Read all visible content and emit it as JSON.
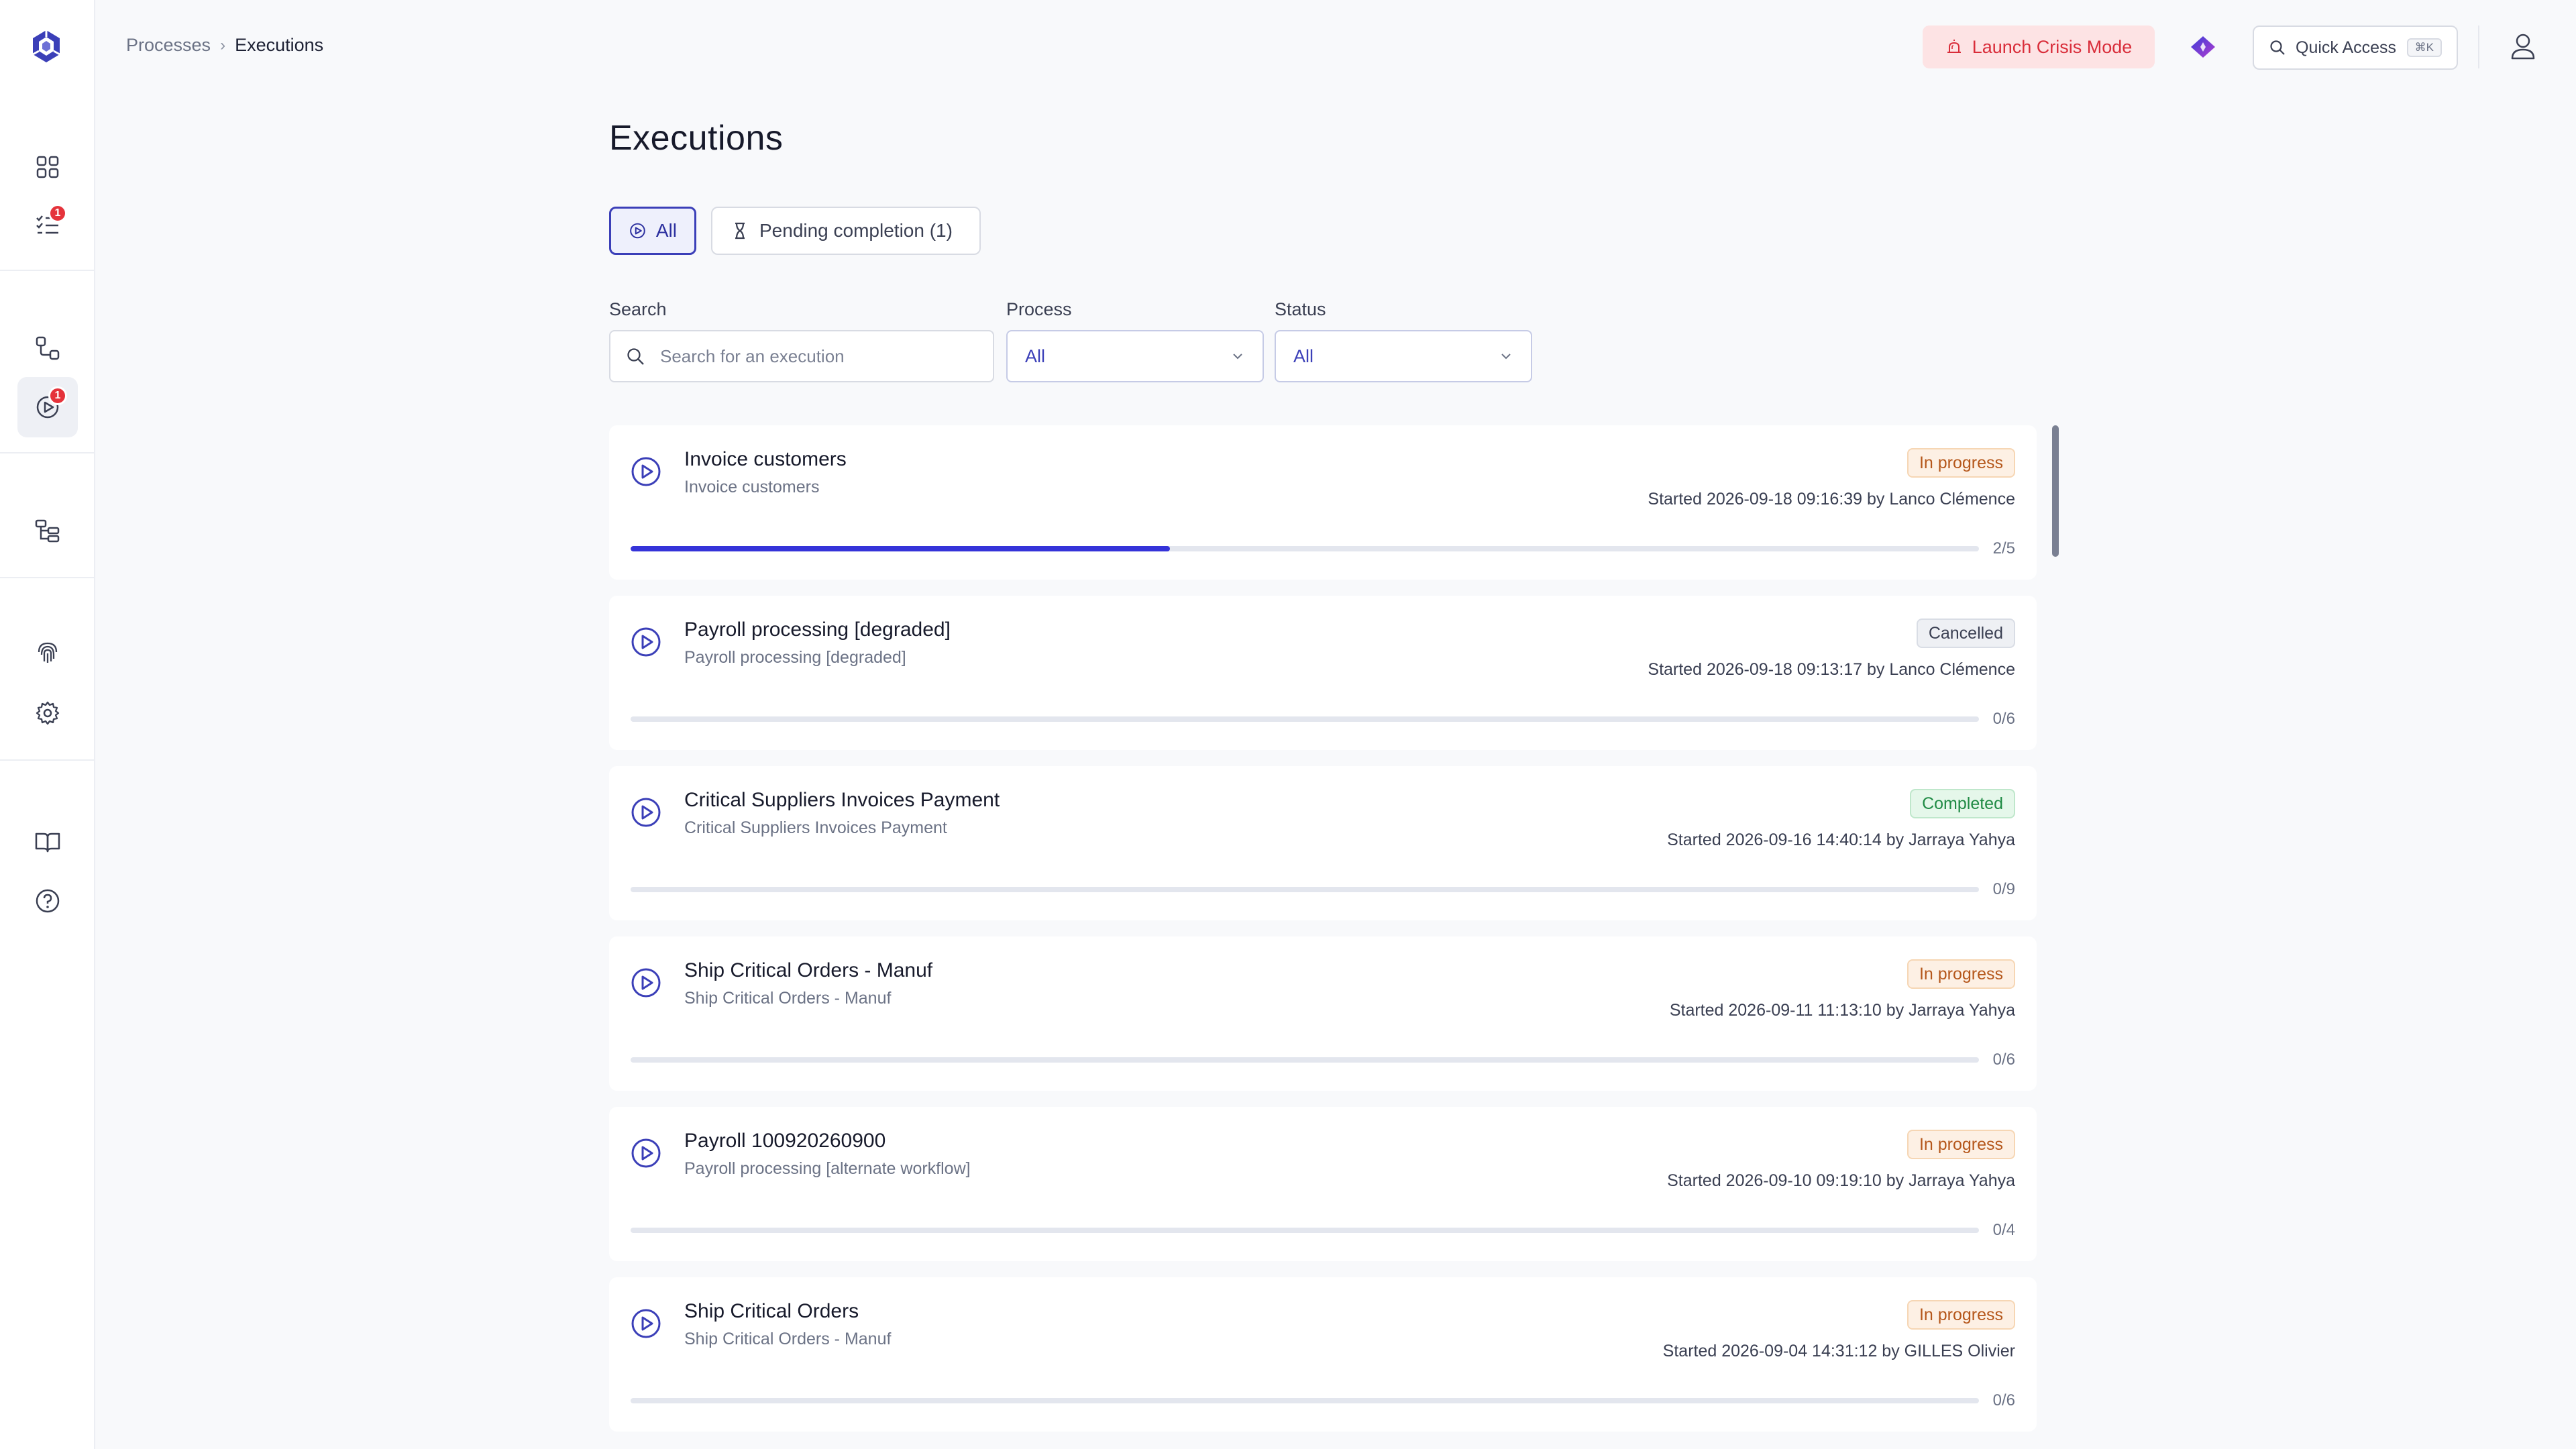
{
  "breadcrumb": {
    "parent": "Processes",
    "separator": "›",
    "current": "Executions"
  },
  "header": {
    "crisis_button": "Launch Crisis Mode",
    "quick_access": {
      "label": "Quick Access",
      "shortcut": "⌘K"
    }
  },
  "sidebar": {
    "badges": {
      "tasks": "1",
      "executions": "1"
    }
  },
  "page": {
    "title": "Executions"
  },
  "tabs": [
    {
      "label": "All"
    },
    {
      "label": "Pending completion (1)"
    }
  ],
  "filters": {
    "search": {
      "label": "Search",
      "placeholder": "Search for an execution"
    },
    "process": {
      "label": "Process",
      "value": "All"
    },
    "status": {
      "label": "Status",
      "value": "All"
    }
  },
  "executions": [
    {
      "name": "Invoice customers",
      "subtitle": "Invoice customers",
      "status": "In progress",
      "status_key": "in-progress",
      "started": "Started 2026-09-18 09:16:39 by Lanco Clémence",
      "progress_label": "2/5",
      "progress": 0.4
    },
    {
      "name": "Payroll processing [degraded]",
      "subtitle": "Payroll processing [degraded]",
      "status": "Cancelled",
      "status_key": "cancelled",
      "started": "Started 2026-09-18 09:13:17 by Lanco Clémence",
      "progress_label": "0/6",
      "progress": 0
    },
    {
      "name": "Critical Suppliers Invoices Payment",
      "subtitle": "Critical Suppliers Invoices Payment",
      "status": "Completed",
      "status_key": "completed",
      "started": "Started 2026-09-16 14:40:14 by Jarraya Yahya",
      "progress_label": "0/9",
      "progress": 0
    },
    {
      "name": "Ship Critical Orders - Manuf",
      "subtitle": "Ship Critical Orders - Manuf",
      "status": "In progress",
      "status_key": "in-progress",
      "started": "Started 2026-09-11 11:13:10 by Jarraya Yahya",
      "progress_label": "0/6",
      "progress": 0
    },
    {
      "name": "Payroll 100920260900",
      "subtitle": "Payroll processing [alternate workflow]",
      "status": "In progress",
      "status_key": "in-progress",
      "started": "Started 2026-09-10 09:19:10 by Jarraya Yahya",
      "progress_label": "0/4",
      "progress": 0
    },
    {
      "name": "Ship Critical Orders",
      "subtitle": "Ship Critical Orders - Manuf",
      "status": "In progress",
      "status_key": "in-progress",
      "started": "Started 2026-09-04 14:31:12 by GILLES Olivier",
      "progress_label": "0/6",
      "progress": 0
    }
  ],
  "colors": {
    "accent": "#3b3fb8",
    "progress": "#3533d9",
    "crisis": "#d92d3a",
    "badge_alert": "#e5333b"
  }
}
